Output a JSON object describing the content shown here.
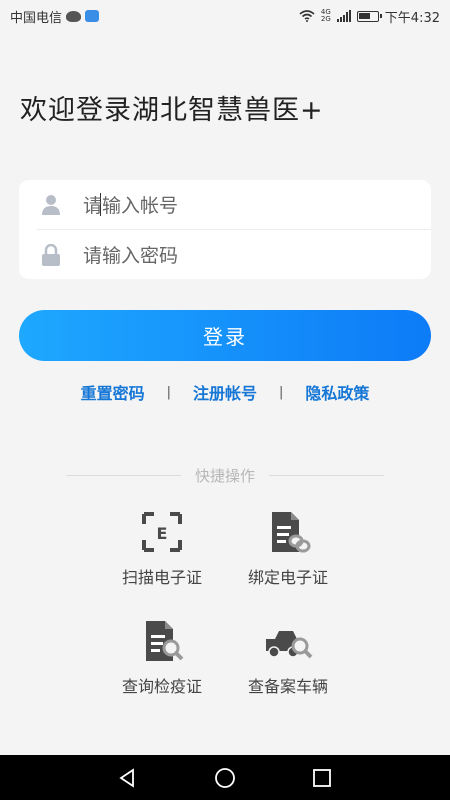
{
  "status_bar": {
    "carrier": "中国电信",
    "network_top": "4G",
    "network_bottom": "2G",
    "time": "下午4:32"
  },
  "welcome": {
    "title": "欢迎登录湖北智慧兽医+"
  },
  "login_form": {
    "account_placeholder": "请输入帐号",
    "account_value": "",
    "password_placeholder": "请输入密码",
    "password_value": "",
    "submit_label": "登录"
  },
  "links": {
    "reset_password": "重置密码",
    "separator": "|",
    "register": "注册帐号",
    "privacy": "隐私政策"
  },
  "quick_actions": {
    "header": "快捷操作",
    "items": [
      {
        "label": "扫描电子证",
        "icon": "scan-certificate-icon"
      },
      {
        "label": "绑定电子证",
        "icon": "bind-certificate-icon"
      },
      {
        "label": "查询检疫证",
        "icon": "search-quarantine-icon"
      },
      {
        "label": "查备案车辆",
        "icon": "search-vehicle-icon"
      }
    ]
  },
  "colors": {
    "accent": "#1677d6",
    "button_start": "#1ea8ff",
    "button_end": "#0d7bf7",
    "icon_gray": "#4a4a4a"
  }
}
